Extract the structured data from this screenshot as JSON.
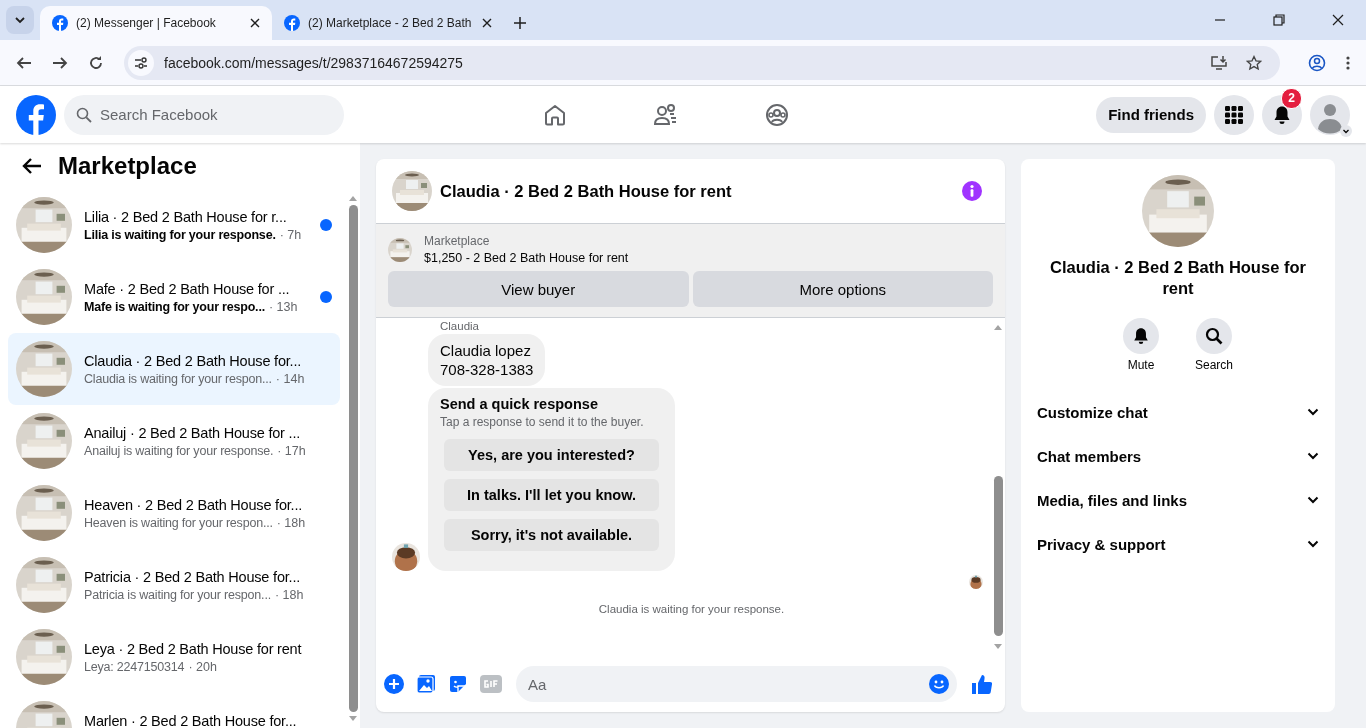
{
  "browser": {
    "tabs": [
      {
        "title": "(2) Messenger | Facebook",
        "selected": true
      },
      {
        "title": "(2) Marketplace - 2 Bed 2 Bath",
        "selected": false
      }
    ],
    "url": "facebook.com/messages/t/29837164672594275"
  },
  "header": {
    "search_placeholder": "Search Facebook",
    "find_friends": "Find friends",
    "notification_count": "2"
  },
  "sidebar": {
    "title": "Marketplace",
    "conversations": [
      {
        "title": "Lilia · 2 Bed 2 Bath House for r...",
        "preview": "Lilia is waiting for your response.",
        "time": "· 7h",
        "unread": true,
        "selected": false
      },
      {
        "title": "Mafe · 2 Bed 2 Bath House for ...",
        "preview": "Mafe is waiting for your respo...",
        "time": "· 13h",
        "unread": true,
        "selected": false
      },
      {
        "title": "Claudia · 2 Bed 2 Bath House for...",
        "preview": "Claudia is waiting for your respon...",
        "time": "· 14h",
        "unread": false,
        "selected": true
      },
      {
        "title": "Anailuj · 2 Bed 2 Bath House for ...",
        "preview": "Anailuj is waiting for your response.",
        "time": "· 17h",
        "unread": false,
        "selected": false
      },
      {
        "title": "Heaven · 2 Bed 2 Bath House for...",
        "preview": "Heaven is waiting for your respon...",
        "time": "· 18h",
        "unread": false,
        "selected": false
      },
      {
        "title": "Patricia · 2 Bed 2 Bath House for...",
        "preview": "Patricia is waiting for your respon...",
        "time": "· 18h",
        "unread": false,
        "selected": false
      },
      {
        "title": "Leya · 2 Bed 2 Bath House for rent",
        "preview": "Leya: 2247150314",
        "time": "· 20h",
        "unread": false,
        "selected": false
      },
      {
        "title": "Marlen · 2 Bed 2 Bath House for...",
        "unread": false,
        "selected": false
      }
    ]
  },
  "chat": {
    "title": "Claudia · 2 Bed 2 Bath House for rent",
    "listing": {
      "label": "Marketplace",
      "text": "$1,250 - 2 Bed 2 Bath House for rent"
    },
    "buttons": [
      "View buyer",
      "More options"
    ],
    "sender": "Claudia",
    "message_lines": [
      "Claudia lopez",
      "708-328-1383"
    ],
    "quick_response": {
      "title": "Send a quick response",
      "subtitle": "Tap a response to send it to the buyer.",
      "options": [
        "Yes, are you interested?",
        "In talks. I'll let you know.",
        "Sorry, it's not available."
      ]
    },
    "status": "Claudia is waiting for your response.",
    "composer_placeholder": "Aa"
  },
  "details": {
    "title": "Claudia · 2 Bed 2 Bath House for rent",
    "actions": [
      {
        "kind": "mute",
        "label": "Mute"
      },
      {
        "kind": "search",
        "label": "Search"
      }
    ],
    "sections": [
      "Customize chat",
      "Chat members",
      "Media, files and links",
      "Privacy & support"
    ]
  }
}
